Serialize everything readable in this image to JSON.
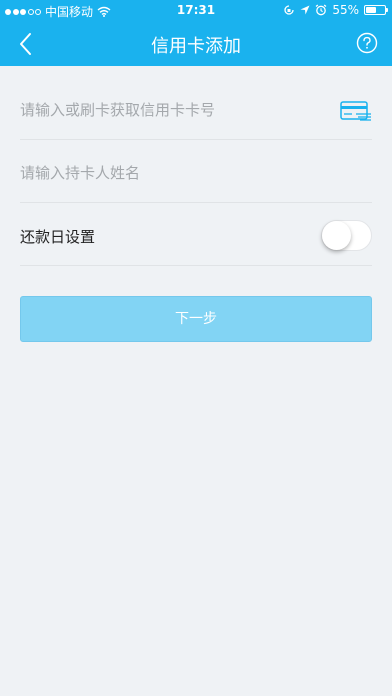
{
  "status_bar": {
    "carrier": "中国移动",
    "time": "17:31",
    "battery_percent": "55%",
    "battery_level": 0.55
  },
  "nav": {
    "title": "信用卡添加",
    "back_icon": "chevron-left-icon",
    "help_icon": "question-circle-icon"
  },
  "form": {
    "card_number_placeholder": "请输入或刷卡获取信用卡卡号",
    "card_number_value": "",
    "holder_name_placeholder": "请输入持卡人姓名",
    "holder_name_value": "",
    "repayment_label": "还款日设置",
    "repayment_enabled": false
  },
  "actions": {
    "next_label": "下一步"
  },
  "colors": {
    "header": "#1ab2ee",
    "page_background": "#eff2f5",
    "button": "#82d4f4",
    "card_icon": "#1ab2ee"
  }
}
